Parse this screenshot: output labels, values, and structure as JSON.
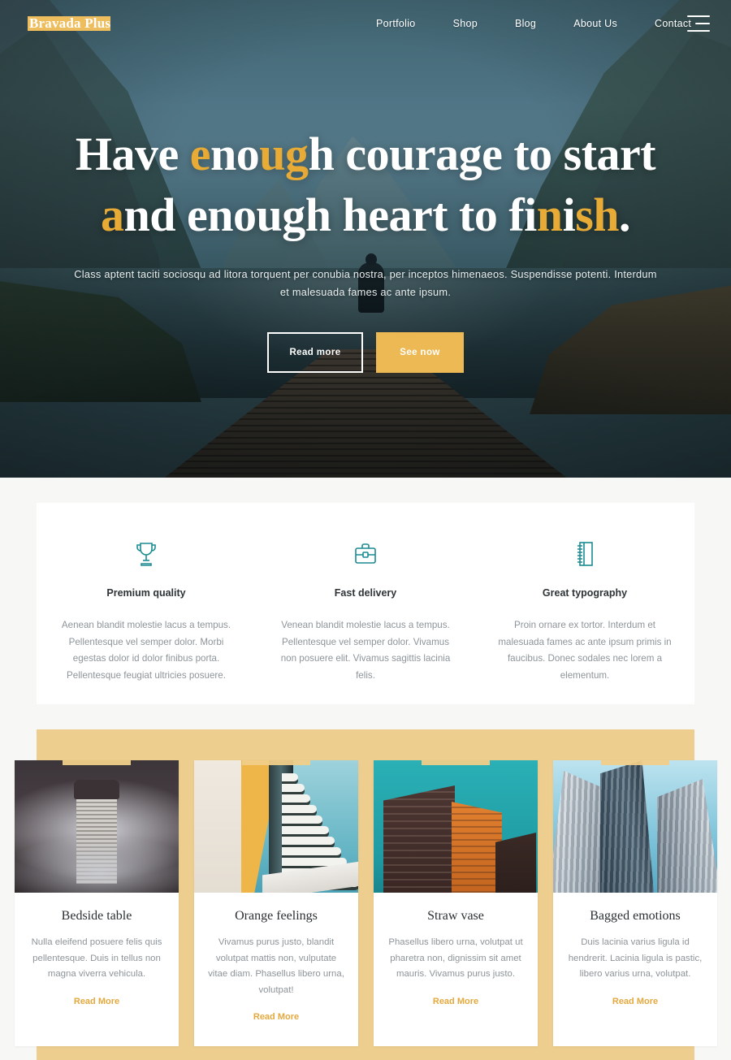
{
  "nav": {
    "logo": "Bravada Plus",
    "links": [
      {
        "label": "Portfolio"
      },
      {
        "label": "Shop"
      },
      {
        "label": "Blog"
      },
      {
        "label": "About Us"
      },
      {
        "label": "Contact"
      }
    ],
    "menu_icon": "hamburger-icon"
  },
  "hero": {
    "headline_segments": [
      {
        "text": "Have ",
        "gold": false
      },
      {
        "text": "e",
        "gold": true
      },
      {
        "text": "no",
        "gold": false
      },
      {
        "text": "ug",
        "gold": true
      },
      {
        "text": "h",
        "gold": false
      },
      {
        "text": " courage to start ",
        "gold": false
      },
      {
        "text": "a",
        "gold": true
      },
      {
        "text": "nd enough heart to fi",
        "gold": false
      },
      {
        "text": "n",
        "gold": true
      },
      {
        "text": "i",
        "gold": false
      },
      {
        "text": "sh",
        "gold": true
      },
      {
        "text": ".",
        "gold": false
      }
    ],
    "headline_plain": "Have enough courage to start and enough heart to finish.",
    "subtitle": "Class aptent taciti sociosqu ad litora torquent per conubia nostra, per inceptos himenaeos. Suspendisse potenti. Interdum et malesuada fames ac ante ipsum.",
    "primary_button": "Read more",
    "secondary_button": "See now"
  },
  "features": [
    {
      "icon": "trophy-icon",
      "title": "Premium quality",
      "text": "Aenean blandit molestie lacus a tempus. Pellentesque vel semper dolor. Morbi egestas dolor id dolor finibus porta. Pellentesque feugiat ultricies posuere."
    },
    {
      "icon": "briefcase-icon",
      "title": "Fast delivery",
      "text": "Venean blandit molestie lacus a tempus. Pellentesque vel semper dolor. Vivamus non posuere elit. Vivamus sagittis lacinia felis."
    },
    {
      "icon": "notebook-icon",
      "title": "Great typography",
      "text": "Proin ornare ex tortor. Interdum et malesuada fames ac ante ipsum primis in faucibus. Donec sodales nec lorem a elementum."
    }
  ],
  "cards": [
    {
      "title": "Bedside table",
      "text": "Nulla eleifend posuere felis quis pellentesque. Duis in tellus non magna viverra vehicula.",
      "link": "Read More",
      "image": "foggy-tower-photo"
    },
    {
      "title": "Orange feelings",
      "text": "Vivamus purus justo, blandit volutpat mattis non, vulputate vitae diam. Phasellus libero urna, volutpat!",
      "link": "Read More",
      "image": "balcony-building-photo"
    },
    {
      "title": "Straw vase",
      "text": "Phasellus libero urna, volutpat ut pharetra non, dignissim sit amet mauris. Vivamus purus justo.",
      "link": "Read More",
      "image": "brick-tower-photo"
    },
    {
      "title": "Bagged emotions",
      "text": "Duis lacinia varius ligula id hendrerit. Lacinia ligula is pastic, libero varius urna, volutpat.",
      "link": "Read More",
      "image": "glass-skyscrapers-photo"
    }
  ],
  "colors": {
    "gold": "#e8ab36",
    "gold_button": "#edb955",
    "gold_band": "#edce8f",
    "highlight": "#f5d796",
    "teal_icon": "#1b8c92",
    "body_text": "#8d9499",
    "link": "#e3a93f",
    "page_bg": "#f7f7f5"
  }
}
